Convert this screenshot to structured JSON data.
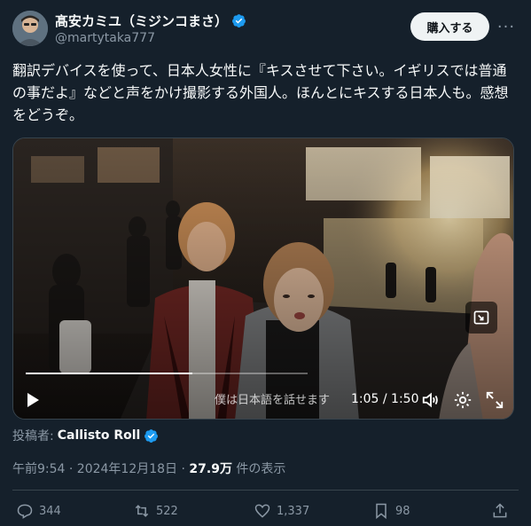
{
  "author": {
    "name": "髙安カミユ（ミジンコまさ）",
    "handle": "@martytaka777",
    "avatar_icon": "person-photo-avatar"
  },
  "header": {
    "buy_label": "購入する",
    "more_icon": "more-dots-icon"
  },
  "tweet": {
    "text": "翻訳デバイスを使って、日本人女性に『キスさせて下さい。イギリスでは普通の事だよ』などと声をかけ撮影する外国人。ほんとにキスする日本人も。感想をどうぞ。"
  },
  "video": {
    "subtitle": "僕は日本語を話せます",
    "time": "1:05 / 1:50",
    "progress": 0.59
  },
  "poster": {
    "label": "投稿者:",
    "name": "Callisto Roll"
  },
  "meta": {
    "time": "午前9:54 · 2024年12月18日 · ",
    "views": "27.9万",
    "views_suffix": " 件の表示"
  },
  "actions": {
    "replies": "344",
    "retweets": "522",
    "likes": "1,337",
    "bookmarks": "98"
  },
  "colors": {
    "background": "#15202b",
    "verified": "#1d9bf0",
    "muted": "#8b98a5"
  }
}
